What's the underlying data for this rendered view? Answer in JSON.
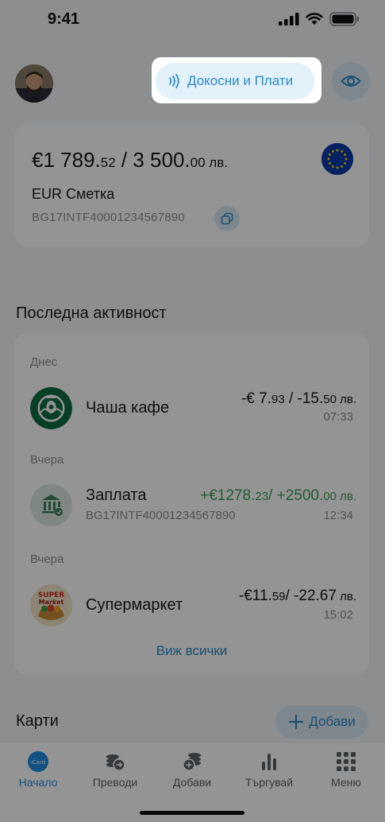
{
  "status_bar": {
    "time": "9:41"
  },
  "header": {
    "tap_to_pay_label": "Докосни и Плати"
  },
  "account": {
    "balance_eur_whole": "€1 789.",
    "balance_eur_frac": "52",
    "balance_sep": " / ",
    "balance_bgn_whole": "3 500.",
    "balance_bgn_frac": "00 лв.",
    "name": "EUR Сметка",
    "iban": "BG17INTF40001234567890"
  },
  "activity": {
    "title": "Последна активност",
    "groups": [
      {
        "day": "Днес"
      },
      {
        "day": "Вчера"
      },
      {
        "day": "Вчера"
      }
    ],
    "transactions": [
      {
        "name": "Чаша кафе",
        "sub": "",
        "amount_a": "-€ 7.",
        "amount_a_frac": "93",
        "amount_b": " / -15.",
        "amount_b_frac": "50 лв.",
        "time": "07:33"
      },
      {
        "name": "Заплата",
        "sub": "BG17INTF40001234567890",
        "amount_a": "+€1278.",
        "amount_a_frac": "23",
        "amount_b": "/ +2500.",
        "amount_b_frac": "00 лв.",
        "time": "12:34"
      },
      {
        "name": "Супермаркет",
        "sub": "",
        "amount_a": "-€11.",
        "amount_a_frac": "59",
        "amount_b": "/ -22.67",
        "amount_b_frac": " лв.",
        "time": "15:02"
      }
    ],
    "see_all": "Виж всички"
  },
  "cards": {
    "title": "Карти",
    "add_label": "Добави"
  },
  "tabs": [
    {
      "label": "Начало",
      "icon": "icard-icon"
    },
    {
      "label": "Преводи",
      "icon": "transfer-icon"
    },
    {
      "label": "Добави",
      "icon": "add-money-icon"
    },
    {
      "label": "Търгувай",
      "icon": "chart-bars-icon"
    },
    {
      "label": "Меню",
      "icon": "grid-menu-icon"
    }
  ],
  "colors": {
    "accent": "#2b8ac6",
    "positive": "#3f9e59",
    "active_tab": "#1f8ae0"
  },
  "brand_marks": {
    "icard_logo_text": "iCard",
    "supermarket_logo_text": "SUPER Market"
  }
}
